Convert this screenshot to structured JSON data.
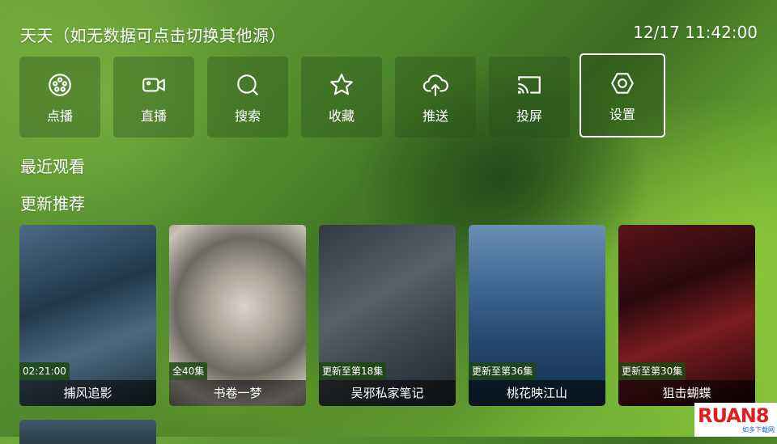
{
  "header": {
    "title": "天天（如无数据可点击切换其他源）",
    "datetime": "12/17 11:42:00"
  },
  "nav": {
    "items": [
      {
        "label": "点播",
        "icon": "film-reel-icon"
      },
      {
        "label": "直播",
        "icon": "video-camera-icon"
      },
      {
        "label": "搜索",
        "icon": "search-icon"
      },
      {
        "label": "收藏",
        "icon": "star-icon"
      },
      {
        "label": "推送",
        "icon": "cloud-upload-icon"
      },
      {
        "label": "投屏",
        "icon": "cast-icon"
      },
      {
        "label": "设置",
        "icon": "gear-icon",
        "selected": true
      }
    ]
  },
  "sections": {
    "recent": "最近观看",
    "recommend": "更新推荐"
  },
  "cards": [
    {
      "title": "捕风追影",
      "badge": "02:21:00"
    },
    {
      "title": "书卷一梦",
      "badge": "全40集"
    },
    {
      "title": "吴邪私家笔记",
      "badge": "更新至第18集"
    },
    {
      "title": "桃花映江山",
      "badge": "更新至第36集"
    },
    {
      "title": "狙击蝴蝶",
      "badge": "更新至第30集"
    }
  ],
  "watermark": {
    "brand": "RUAN8",
    "sub": "如多下载网"
  }
}
